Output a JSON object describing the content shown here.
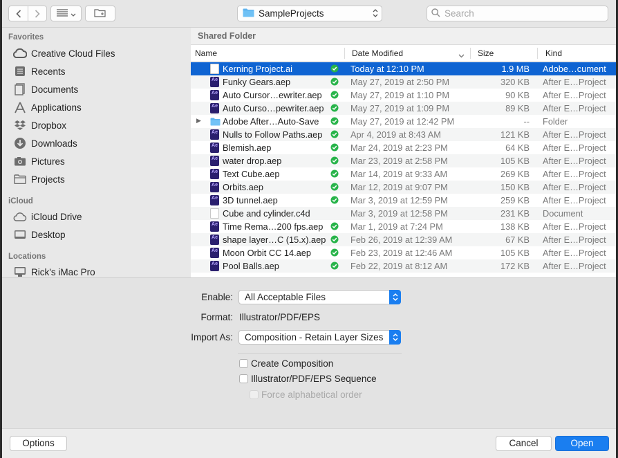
{
  "toolbar": {
    "back_icon": "chevron-left-icon",
    "forward_icon": "chevron-right-icon",
    "view_icon": "list-view-icon",
    "new_folder_icon": "new-folder-icon",
    "location": "SampleProjects",
    "search_placeholder": "Search"
  },
  "sidebar": {
    "favorites_heading": "Favorites",
    "favorites": [
      {
        "label": "Creative Cloud Files",
        "icon": "creative-cloud-icon"
      },
      {
        "label": "Recents",
        "icon": "recents-icon"
      },
      {
        "label": "Documents",
        "icon": "documents-icon"
      },
      {
        "label": "Applications",
        "icon": "applications-icon"
      },
      {
        "label": "Dropbox",
        "icon": "dropbox-icon"
      },
      {
        "label": "Downloads",
        "icon": "downloads-icon"
      },
      {
        "label": "Pictures",
        "icon": "pictures-icon"
      },
      {
        "label": "Projects",
        "icon": "folder-icon"
      }
    ],
    "icloud_heading": "iCloud",
    "icloud": [
      {
        "label": "iCloud Drive",
        "icon": "icloud-icon"
      },
      {
        "label": "Desktop",
        "icon": "desktop-icon"
      }
    ],
    "locations_heading": "Locations",
    "locations": [
      {
        "label": "Rick's iMac Pro",
        "icon": "imac-icon"
      }
    ]
  },
  "browser": {
    "title": "Shared Folder",
    "columns": {
      "name": "Name",
      "date": "Date Modified",
      "size": "Size",
      "kind": "Kind"
    },
    "files": [
      {
        "name": "Kerning Project.ai",
        "date": "Today at 12:10 PM",
        "size": "1.9 MB",
        "kind": "Adobe…cument",
        "type": "doc",
        "selected": true
      },
      {
        "name": "Funky Gears.aep",
        "date": "May 27, 2019 at 2:50 PM",
        "size": "320 KB",
        "kind": "After E…Project",
        "type": "ae"
      },
      {
        "name": "Auto Cursor…ewriter.aep",
        "date": "May 27, 2019 at 1:10 PM",
        "size": "90 KB",
        "kind": "After E…Project",
        "type": "ae"
      },
      {
        "name": "Auto Curso…pewriter.aep",
        "date": "May 27, 2019 at 1:09 PM",
        "size": "89 KB",
        "kind": "After E…Project",
        "type": "ae"
      },
      {
        "name": "Adobe After…Auto-Save",
        "date": "May 27, 2019 at 12:42 PM",
        "size": "--",
        "kind": "Folder",
        "type": "folder"
      },
      {
        "name": "Nulls to Follow Paths.aep",
        "date": "Apr 4, 2019 at 8:43 AM",
        "size": "121 KB",
        "kind": "After E…Project",
        "type": "ae"
      },
      {
        "name": "Blemish.aep",
        "date": "Mar 24, 2019 at 2:23 PM",
        "size": "64 KB",
        "kind": "After E…Project",
        "type": "ae"
      },
      {
        "name": "water drop.aep",
        "date": "Mar 23, 2019 at 2:58 PM",
        "size": "105 KB",
        "kind": "After E…Project",
        "type": "ae"
      },
      {
        "name": "Text Cube.aep",
        "date": "Mar 14, 2019 at 9:33 AM",
        "size": "269 KB",
        "kind": "After E…Project",
        "type": "ae"
      },
      {
        "name": "Orbits.aep",
        "date": "Mar 12, 2019 at 9:07 PM",
        "size": "150 KB",
        "kind": "After E…Project",
        "type": "ae"
      },
      {
        "name": "3D tunnel.aep",
        "date": "Mar 3, 2019 at 12:59 PM",
        "size": "259 KB",
        "kind": "After E…Project",
        "type": "ae"
      },
      {
        "name": "Cube and cylinder.c4d",
        "date": "Mar 3, 2019 at 12:58 PM",
        "size": "231 KB",
        "kind": "Document",
        "type": "doc"
      },
      {
        "name": "Time Rema…200 fps.aep",
        "date": "Mar 1, 2019 at 7:24 PM",
        "size": "138 KB",
        "kind": "After E…Project",
        "type": "ae"
      },
      {
        "name": "shape layer…C (15.x).aep",
        "date": "Feb 26, 2019 at 12:39 AM",
        "size": "67 KB",
        "kind": "After E…Project",
        "type": "ae"
      },
      {
        "name": "Moon Orbit CC 14.aep",
        "date": "Feb 23, 2019 at 12:46 AM",
        "size": "105 KB",
        "kind": "After E…Project",
        "type": "ae"
      },
      {
        "name": "Pool Balls.aep",
        "date": "Feb 22, 2019 at 8:12 AM",
        "size": "172 KB",
        "kind": "After E…Project",
        "type": "ae"
      }
    ]
  },
  "options": {
    "enable_label": "Enable:",
    "enable_value": "All Acceptable Files",
    "format_label": "Format:",
    "format_value": "Illustrator/PDF/EPS",
    "import_label": "Import As:",
    "import_value": "Composition - Retain Layer Sizes",
    "create_composition": "Create Composition",
    "sequence": "Illustrator/PDF/EPS Sequence",
    "force_alpha": "Force alphabetical order"
  },
  "buttons": {
    "options": "Options",
    "cancel": "Cancel",
    "open": "Open"
  },
  "colors": {
    "accent": "#1a7ef0",
    "selection": "#0f64d2",
    "sync_green": "#28b44a"
  }
}
